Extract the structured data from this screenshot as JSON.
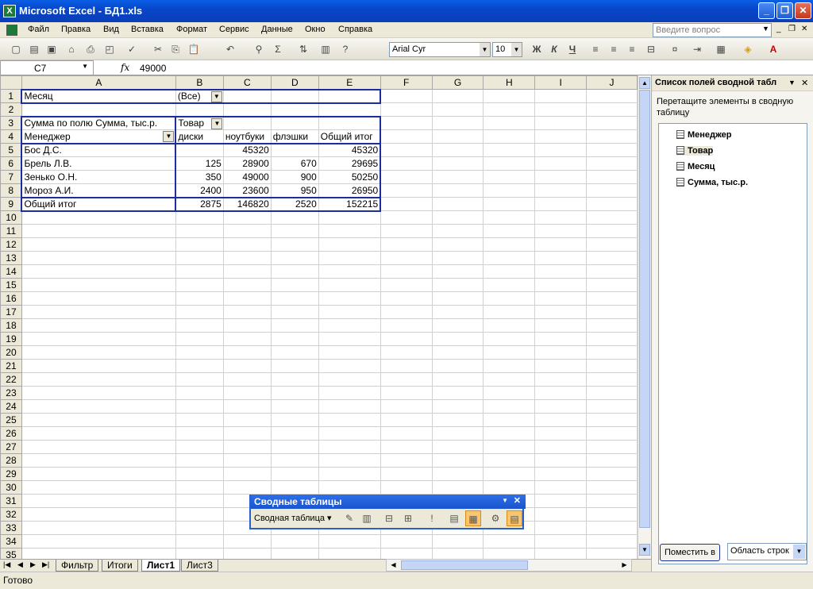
{
  "window": {
    "title": "Microsoft Excel - БД1.xls"
  },
  "menu": [
    "Файл",
    "Правка",
    "Вид",
    "Вставка",
    "Формат",
    "Сервис",
    "Данные",
    "Окно",
    "Справка"
  ],
  "ask_placeholder": "Введите вопрос",
  "format": {
    "font": "Arial Cyr",
    "size": "10",
    "bold": "Ж",
    "italic": "К",
    "underline": "Ч"
  },
  "formula": {
    "cell": "C7",
    "fx": "fx",
    "value": "49000"
  },
  "columns": [
    "A",
    "B",
    "C",
    "D",
    "E",
    "F",
    "G",
    "H",
    "I",
    "J"
  ],
  "cells": {
    "a1": "Месяц",
    "b1": "(Все)",
    "a3": "Сумма по полю Сумма, тыс.р.",
    "b3": "Товар",
    "a4": "Менеджер",
    "b4": "диски",
    "c4": "ноутбуки",
    "d4": "флэшки",
    "e4": "Общий итог",
    "rows": [
      {
        "name": "Бос Д.С.",
        "b": "",
        "c": "45320",
        "d": "",
        "e": "45320"
      },
      {
        "name": "Брель Л.В.",
        "b": "125",
        "c": "28900",
        "d": "670",
        "e": "29695"
      },
      {
        "name": "Зенько О.Н.",
        "b": "350",
        "c": "49000",
        "d": "900",
        "e": "50250"
      },
      {
        "name": "Мороз А.И.",
        "b": "2400",
        "c": "23600",
        "d": "950",
        "e": "26950"
      },
      {
        "name": "Общий итог",
        "b": "2875",
        "c": "146820",
        "d": "2520",
        "e": "152215"
      }
    ]
  },
  "sheets": [
    "Фильтр",
    "Итоги",
    "Лист1",
    "Лист3"
  ],
  "active_sheet": "Лист1",
  "status": "Готово",
  "taskpane": {
    "title": "Список полей сводной табл",
    "description": "Перетащите элементы в сводную таблицу",
    "fields": [
      "Менеджер",
      "Товар",
      "Месяц",
      "Сумма, тыс.р."
    ],
    "place_button": "Поместить в",
    "area": "Область строк"
  },
  "pivot_toolbar": {
    "title": "Сводные таблицы",
    "menu": "Сводная таблица"
  }
}
